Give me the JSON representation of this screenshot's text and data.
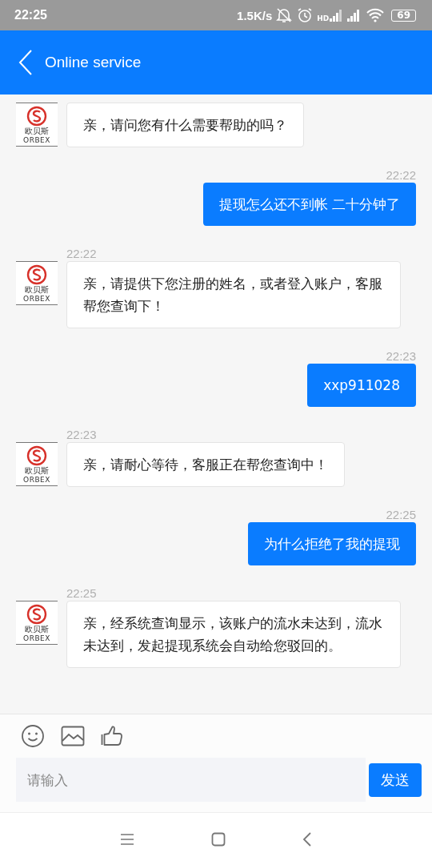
{
  "status_bar": {
    "time": "22:25",
    "net_speed": "1.5K/s",
    "signal_label": "HD",
    "battery": "69"
  },
  "header": {
    "title": "Online service"
  },
  "messages": [
    {
      "kind": "agent",
      "logo_name": "欧贝斯",
      "logo_sub": "ORBEX",
      "text": "亲，请问您有什么需要帮助的吗？"
    },
    {
      "kind": "user",
      "time": "22:22",
      "text": "提现怎么还不到帐 二十分钟了"
    },
    {
      "kind": "agent",
      "time": "22:22",
      "logo_name": "欧贝斯",
      "logo_sub": "ORBEX",
      "text": "亲，请提供下您注册的姓名，或者登入账户，客服帮您查询下！"
    },
    {
      "kind": "user",
      "time": "22:23",
      "text": "xxp911028"
    },
    {
      "kind": "agent",
      "time": "22:23",
      "logo_name": "欧贝斯",
      "logo_sub": "ORBEX",
      "text": "亲，请耐心等待，客服正在帮您查询中！"
    },
    {
      "kind": "user",
      "time": "22:25",
      "text": "为什么拒绝了我的提现"
    },
    {
      "kind": "agent",
      "time": "22:25",
      "logo_name": "欧贝斯",
      "logo_sub": "ORBEX",
      "text": "亲，经系统查询显示，该账户的流水未达到，流水未达到，发起提现系统会自动给您驳回的。"
    }
  ],
  "composer": {
    "placeholder": "请输入",
    "send": "发送"
  }
}
